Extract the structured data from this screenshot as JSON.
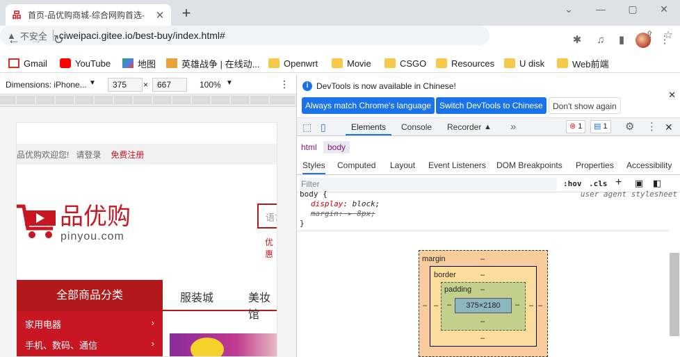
{
  "browser": {
    "tab_title": "首页-品优购商城-综合网购首选-",
    "tab_favicon": "品",
    "url_warning": "不安全",
    "url": "ciweipaci.gitee.io/best-buy/index.html#",
    "new_tab": "+",
    "minimize": "⌄",
    "win_min": "—",
    "win_max": "▢",
    "win_close": "✕"
  },
  "bookmarks": [
    {
      "label": "Gmail",
      "icon": "gmail-icon"
    },
    {
      "label": "YouTube",
      "icon": "youtube-icon"
    },
    {
      "label": "地图",
      "icon": "maps-icon"
    },
    {
      "label": "英雄战争 | 在线动...",
      "icon": "site-icon"
    },
    {
      "label": "Openwrt",
      "icon": "folder-icon"
    },
    {
      "label": "Movie",
      "icon": "folder-icon"
    },
    {
      "label": "CSGO",
      "icon": "folder-icon"
    },
    {
      "label": "Resources",
      "icon": "folder-icon"
    },
    {
      "label": "U disk",
      "icon": "folder-icon"
    },
    {
      "label": "Web前端",
      "icon": "folder-icon"
    }
  ],
  "device_toolbar": {
    "dimensions_label": "Dimensions: iPhone...",
    "width": "375",
    "times": "×",
    "height": "667",
    "zoom": "100%"
  },
  "page": {
    "welcome": "品优购欢迎您!",
    "login": "请登录",
    "register": "免费注册",
    "logo_text": "品优购",
    "logo_sub": "pinyou.com",
    "search_placeholder": "语言",
    "hot_word": "优惠",
    "category_button": "全部商品分类",
    "nav_links": [
      "服装城",
      "美妆馆"
    ],
    "categories": [
      "家用电器",
      "手机、数码、通信"
    ],
    "chevron": "›"
  },
  "devtools": {
    "info_text": "DevTools is now available in Chinese!",
    "btn_match": "Always match Chrome's language",
    "btn_switch": "Switch DevTools to Chinese",
    "btn_dont_show": "Don't show again",
    "tabs": [
      "Elements",
      "Console",
      "Recorder"
    ],
    "more": "»",
    "errors": "1",
    "messages": "1",
    "crumbs": [
      "html",
      "body"
    ],
    "subtabs": [
      "Styles",
      "Computed",
      "Layout",
      "Event Listeners",
      "DOM Breakpoints",
      "Properties",
      "Accessibility"
    ],
    "filter_placeholder": "Filter",
    "hov": ":hov",
    "cls": ".cls",
    "plus": "+",
    "rule_selector": "body {",
    "rule_source": "user agent stylesheet",
    "rule_prop1": "display",
    "rule_val1": "block;",
    "rule_prop2": "margin:",
    "rule_val2": "8px;",
    "rule_close": "}",
    "box": {
      "margin_label": "margin",
      "border_label": "border",
      "padding_label": "padding",
      "dash": "–",
      "content": "375×2180"
    }
  },
  "colors": {
    "accent": "#1a73e8",
    "brand_red": "#c81623",
    "category_bg": "#b1191a"
  }
}
